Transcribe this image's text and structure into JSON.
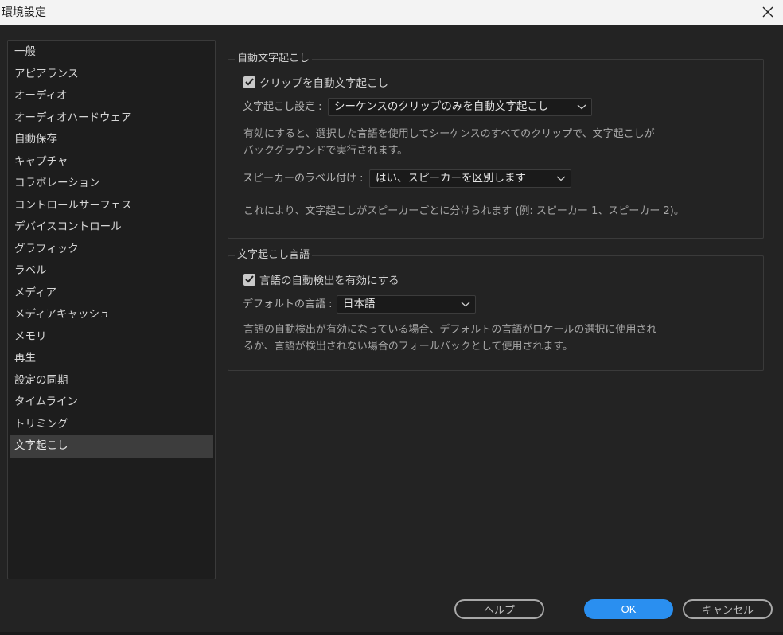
{
  "window": {
    "title": "環境設定"
  },
  "sidebar": {
    "items": [
      {
        "label": "一般"
      },
      {
        "label": "アピアランス"
      },
      {
        "label": "オーディオ"
      },
      {
        "label": "オーディオハードウェア"
      },
      {
        "label": "自動保存"
      },
      {
        "label": "キャプチャ"
      },
      {
        "label": "コラボレーション"
      },
      {
        "label": "コントロールサーフェス"
      },
      {
        "label": "デバイスコントロール"
      },
      {
        "label": "グラフィック"
      },
      {
        "label": "ラベル"
      },
      {
        "label": "メディア"
      },
      {
        "label": "メディアキャッシュ"
      },
      {
        "label": "メモリ"
      },
      {
        "label": "再生"
      },
      {
        "label": "設定の同期"
      },
      {
        "label": "タイムライン"
      },
      {
        "label": "トリミング"
      },
      {
        "label": "文字起こし"
      }
    ],
    "selected_label": "文字起こし"
  },
  "auto_transcribe": {
    "group_title": "自動文字起こし",
    "checkbox_label": "クリップを自動文字起こし",
    "checkbox_checked": true,
    "setting_label": "文字起こし設定 :",
    "setting_value": "シーケンスのクリップのみを自動文字起こし",
    "setting_desc_line1": "有効にすると、選択した言語を使用してシーケンスのすべてのクリップで、文字起こしが",
    "setting_desc_line2": "バックグラウンドで実行されます。",
    "speaker_label": "スピーカーのラベル付け :",
    "speaker_value": "はい、スピーカーを区別します",
    "speaker_desc": "これにより、文字起こしがスピーカーごとに分けられます (例: スピーカー 1、スピーカー 2)。"
  },
  "transcription_language": {
    "group_title": "文字起こし言語",
    "checkbox_label": "言語の自動検出を有効にする",
    "checkbox_checked": true,
    "default_label": "デフォルトの言語 :",
    "default_value": "日本語",
    "desc_line1": "言語の自動検出が有効になっている場合、デフォルトの言語がロケールの選択に使用され",
    "desc_line2": "るか、言語が検出されない場合のフォールバックとして使用されます。"
  },
  "buttons": {
    "help": "ヘルプ",
    "ok": "OK",
    "cancel": "キャンセル"
  },
  "colors": {
    "background": "#232323",
    "accent": "#2a8ff0"
  }
}
